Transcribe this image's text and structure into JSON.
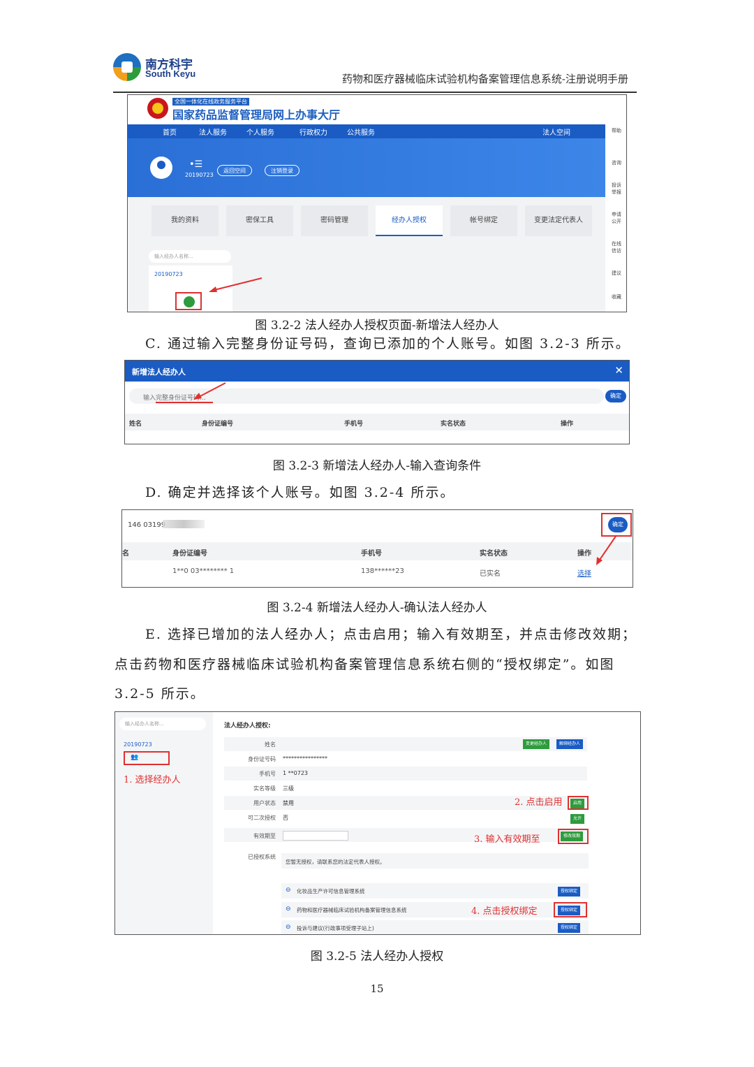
{
  "header": {
    "logo_cn": "南方科宇",
    "logo_en": "South Keyu",
    "doc_title": "药物和医疗器械临床试验机构备案管理信息系统-注册说明手册"
  },
  "fig1": {
    "banner_small": "全国一体化在线政务服务平台",
    "banner_title": "国家药品监督管理局网上办事大厅",
    "nav": [
      "首页",
      "法人服务",
      "个人服务",
      "行政权力",
      "公共服务"
    ],
    "nav_right": "法人空间",
    "user_id": "20190723",
    "menu_glyph": "•☰",
    "pills": [
      "返回空间",
      "注销登录"
    ],
    "tabs": [
      "我的资料",
      "密保工具",
      "密码管理",
      "经办人授权",
      "帐号绑定",
      "变更法定代表人"
    ],
    "active_tab": 3,
    "search_placeholder": "输入经办人名称...",
    "tree_id": "20190723",
    "side": [
      "帮助",
      "咨询",
      "投诉举报",
      "申请公开",
      "在线信访",
      "建议",
      "收藏"
    ],
    "caption": "图 3.2-2  法人经办人授权页面-新增法人经办人"
  },
  "para_c": "C.  通过输入完整身份证号码，查询已添加的个人账号。如图 3.2-3 所示。",
  "fig2": {
    "title": "新增法人经办人",
    "close": "✕",
    "placeholder": "输入完整身份证号码...",
    "ok": "确定",
    "columns": [
      "姓名",
      "身份证编号",
      "手机号",
      "实名状态",
      "操作"
    ],
    "caption": "图 3.2-3  新增法人经办人-输入查询条件"
  },
  "para_d": "D.  确定并选择该个人账号。如图 3.2-4 所示。",
  "fig3": {
    "input_value": "146 03199",
    "ok": "确定",
    "columns": [
      "名",
      "身份证编号",
      "手机号",
      "实名状态",
      "操作"
    ],
    "row": {
      "idno": "1**0  03********  1",
      "phone": "138******23",
      "status": "已实名",
      "action": "选择"
    },
    "caption": "图 3.2-4  新增法人经办人-确认法人经办人"
  },
  "para_e1": "E.  选择已增加的法人经办人；点击启用；输入有效期至，并点击修改效期；",
  "para_e2": "点击药物和医疗器械临床试验机构备案管理信息系统右侧的“授权绑定”。如图",
  "para_e3": "3.2-5 所示。",
  "fig4": {
    "search_placeholder": "输入经办人名称...",
    "tree_id": "20190723",
    "heading": "法人经办人授权:",
    "labels": [
      "姓名",
      "身份证号码",
      "手机号",
      "实名等级",
      "用户状态",
      "可二次授权",
      "有效期至",
      "已授权系统"
    ],
    "values": [
      "",
      "****************",
      "1    **0723",
      "三级",
      "禁用",
      "否",
      "",
      "您暂无授权，请联系您的法定代表人授权。"
    ],
    "btn_change": "变更经办人",
    "btn_unbind": "解绑经办人",
    "btn_enable": "启用",
    "btn_allow": "允许",
    "btn_modify": "修改效期",
    "systems": [
      "化妆品生产许可信息管理系统",
      "药物和医疗器械临床试验机构备案管理信息系统",
      "投诉与建议(行政事项受理子站上)"
    ],
    "btn_bind": "授权绑定",
    "notes": [
      "1. 选择经办人",
      "2. 点击启用",
      "3. 输入有效期至",
      "4. 点击授权绑定"
    ],
    "caption": "图 3.2-5  法人经办人授权"
  },
  "page_number": "15",
  "colors": {
    "accent": "#1a5cc4",
    "green": "#2e9b3d",
    "annotation": "#e03030"
  }
}
